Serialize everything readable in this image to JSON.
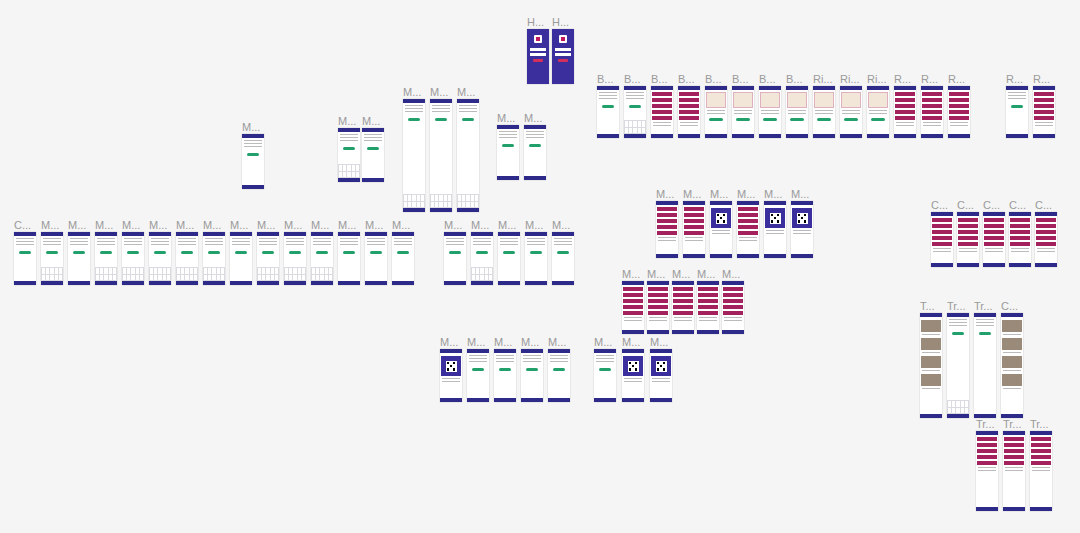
{
  "canvas": {
    "groups": [
      {
        "frames": [
          {
            "label": "H...",
            "kind": "login"
          },
          {
            "label": "H...",
            "kind": "login"
          }
        ]
      },
      {
        "frames": [
          {
            "label": "B...",
            "kind": "form"
          },
          {
            "label": "B...",
            "kind": "keyboard"
          },
          {
            "label": "B...",
            "kind": "list"
          },
          {
            "label": "B...",
            "kind": "list"
          },
          {
            "label": "B...",
            "kind": "map"
          },
          {
            "label": "B...",
            "kind": "map"
          },
          {
            "label": "B...",
            "kind": "map"
          },
          {
            "label": "B...",
            "kind": "map"
          },
          {
            "label": "Ri...",
            "kind": "map"
          },
          {
            "label": "Ri...",
            "kind": "map"
          },
          {
            "label": "Ri...",
            "kind": "map"
          },
          {
            "label": "R...",
            "kind": "list"
          },
          {
            "label": "R...",
            "kind": "list"
          },
          {
            "label": "R...",
            "kind": "list"
          }
        ]
      },
      {
        "frames": [
          {
            "label": "R...",
            "kind": "form"
          },
          {
            "label": "R...",
            "kind": "list"
          }
        ]
      },
      {
        "frames": [
          {
            "label": "M...",
            "kind": "form"
          }
        ]
      },
      {
        "frames": [
          {
            "label": "M...",
            "kind": "keyboard"
          },
          {
            "label": "M...",
            "kind": "form"
          }
        ]
      },
      {
        "frames": [
          {
            "label": "M...",
            "kind": "keyboard"
          },
          {
            "label": "M...",
            "kind": "keyboard"
          },
          {
            "label": "M...",
            "kind": "keyboard"
          }
        ]
      },
      {
        "frames": [
          {
            "label": "M...",
            "kind": "form"
          },
          {
            "label": "M...",
            "kind": "form"
          }
        ]
      },
      {
        "frames": [
          {
            "label": "C...",
            "kind": "form"
          },
          {
            "label": "M...",
            "kind": "keyboard"
          },
          {
            "label": "M...",
            "kind": "form"
          },
          {
            "label": "M...",
            "kind": "keyboard"
          },
          {
            "label": "M...",
            "kind": "keyboard"
          },
          {
            "label": "M...",
            "kind": "keyboard"
          },
          {
            "label": "M...",
            "kind": "keyboard"
          },
          {
            "label": "M...",
            "kind": "keyboard"
          },
          {
            "label": "M...",
            "kind": "form"
          },
          {
            "label": "M...",
            "kind": "keyboard"
          },
          {
            "label": "M...",
            "kind": "keyboard"
          },
          {
            "label": "M...",
            "kind": "keyboard"
          },
          {
            "label": "M...",
            "kind": "form"
          },
          {
            "label": "M...",
            "kind": "form"
          },
          {
            "label": "M...",
            "kind": "form"
          }
        ]
      },
      {
        "frames": [
          {
            "label": "M...",
            "kind": "form"
          },
          {
            "label": "M...",
            "kind": "keyboard"
          },
          {
            "label": "M...",
            "kind": "form"
          },
          {
            "label": "M...",
            "kind": "form"
          },
          {
            "label": "M...",
            "kind": "form"
          }
        ]
      },
      {
        "frames": [
          {
            "label": "M...",
            "kind": "list"
          },
          {
            "label": "M...",
            "kind": "list"
          },
          {
            "label": "M...",
            "kind": "qr"
          },
          {
            "label": "M...",
            "kind": "list"
          },
          {
            "label": "M...",
            "kind": "qr"
          },
          {
            "label": "M...",
            "kind": "qr"
          }
        ]
      },
      {
        "frames": [
          {
            "label": "M...",
            "kind": "list"
          },
          {
            "label": "M...",
            "kind": "list"
          },
          {
            "label": "M...",
            "kind": "list"
          },
          {
            "label": "M...",
            "kind": "list"
          },
          {
            "label": "M...",
            "kind": "list"
          }
        ]
      },
      {
        "frames": [
          {
            "label": "M...",
            "kind": "qr"
          },
          {
            "label": "M...",
            "kind": "form"
          },
          {
            "label": "M...",
            "kind": "form"
          },
          {
            "label": "M...",
            "kind": "form"
          },
          {
            "label": "M...",
            "kind": "form"
          }
        ]
      },
      {
        "frames": [
          {
            "label": "M...",
            "kind": "form"
          },
          {
            "label": "M...",
            "kind": "qr"
          },
          {
            "label": "M...",
            "kind": "qr"
          }
        ]
      },
      {
        "frames": [
          {
            "label": "C...",
            "kind": "list"
          },
          {
            "label": "C...",
            "kind": "list"
          },
          {
            "label": "C...",
            "kind": "list"
          },
          {
            "label": "C...",
            "kind": "list"
          },
          {
            "label": "C...",
            "kind": "list"
          }
        ]
      },
      {
        "frames": [
          {
            "label": "T...",
            "kind": "photo"
          },
          {
            "label": "Tr...",
            "kind": "keyboard"
          },
          {
            "label": "Tr...",
            "kind": "form"
          },
          {
            "label": "C...",
            "kind": "photo"
          }
        ]
      },
      {
        "frames": [
          {
            "label": "Tr...",
            "kind": "list"
          },
          {
            "label": "Tr...",
            "kind": "list"
          },
          {
            "label": "Tr...",
            "kind": "list"
          }
        ]
      }
    ]
  }
}
